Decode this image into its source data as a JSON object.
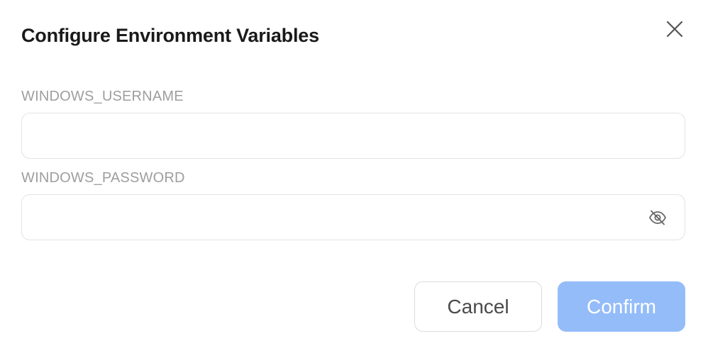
{
  "dialog": {
    "title": "Configure Environment Variables"
  },
  "fields": {
    "username": {
      "label": "WINDOWS_USERNAME",
      "value": "",
      "placeholder": ""
    },
    "password": {
      "label": "WINDOWS_PASSWORD",
      "value": "",
      "placeholder": ""
    }
  },
  "buttons": {
    "cancel_label": "Cancel",
    "confirm_label": "Confirm"
  },
  "icons": {
    "close": "close-icon",
    "visibility": "eye-off-icon"
  },
  "colors": {
    "confirm_bg": "#94bcf9",
    "label_text": "#9e9e9e",
    "title_text": "#1a1a1a"
  }
}
